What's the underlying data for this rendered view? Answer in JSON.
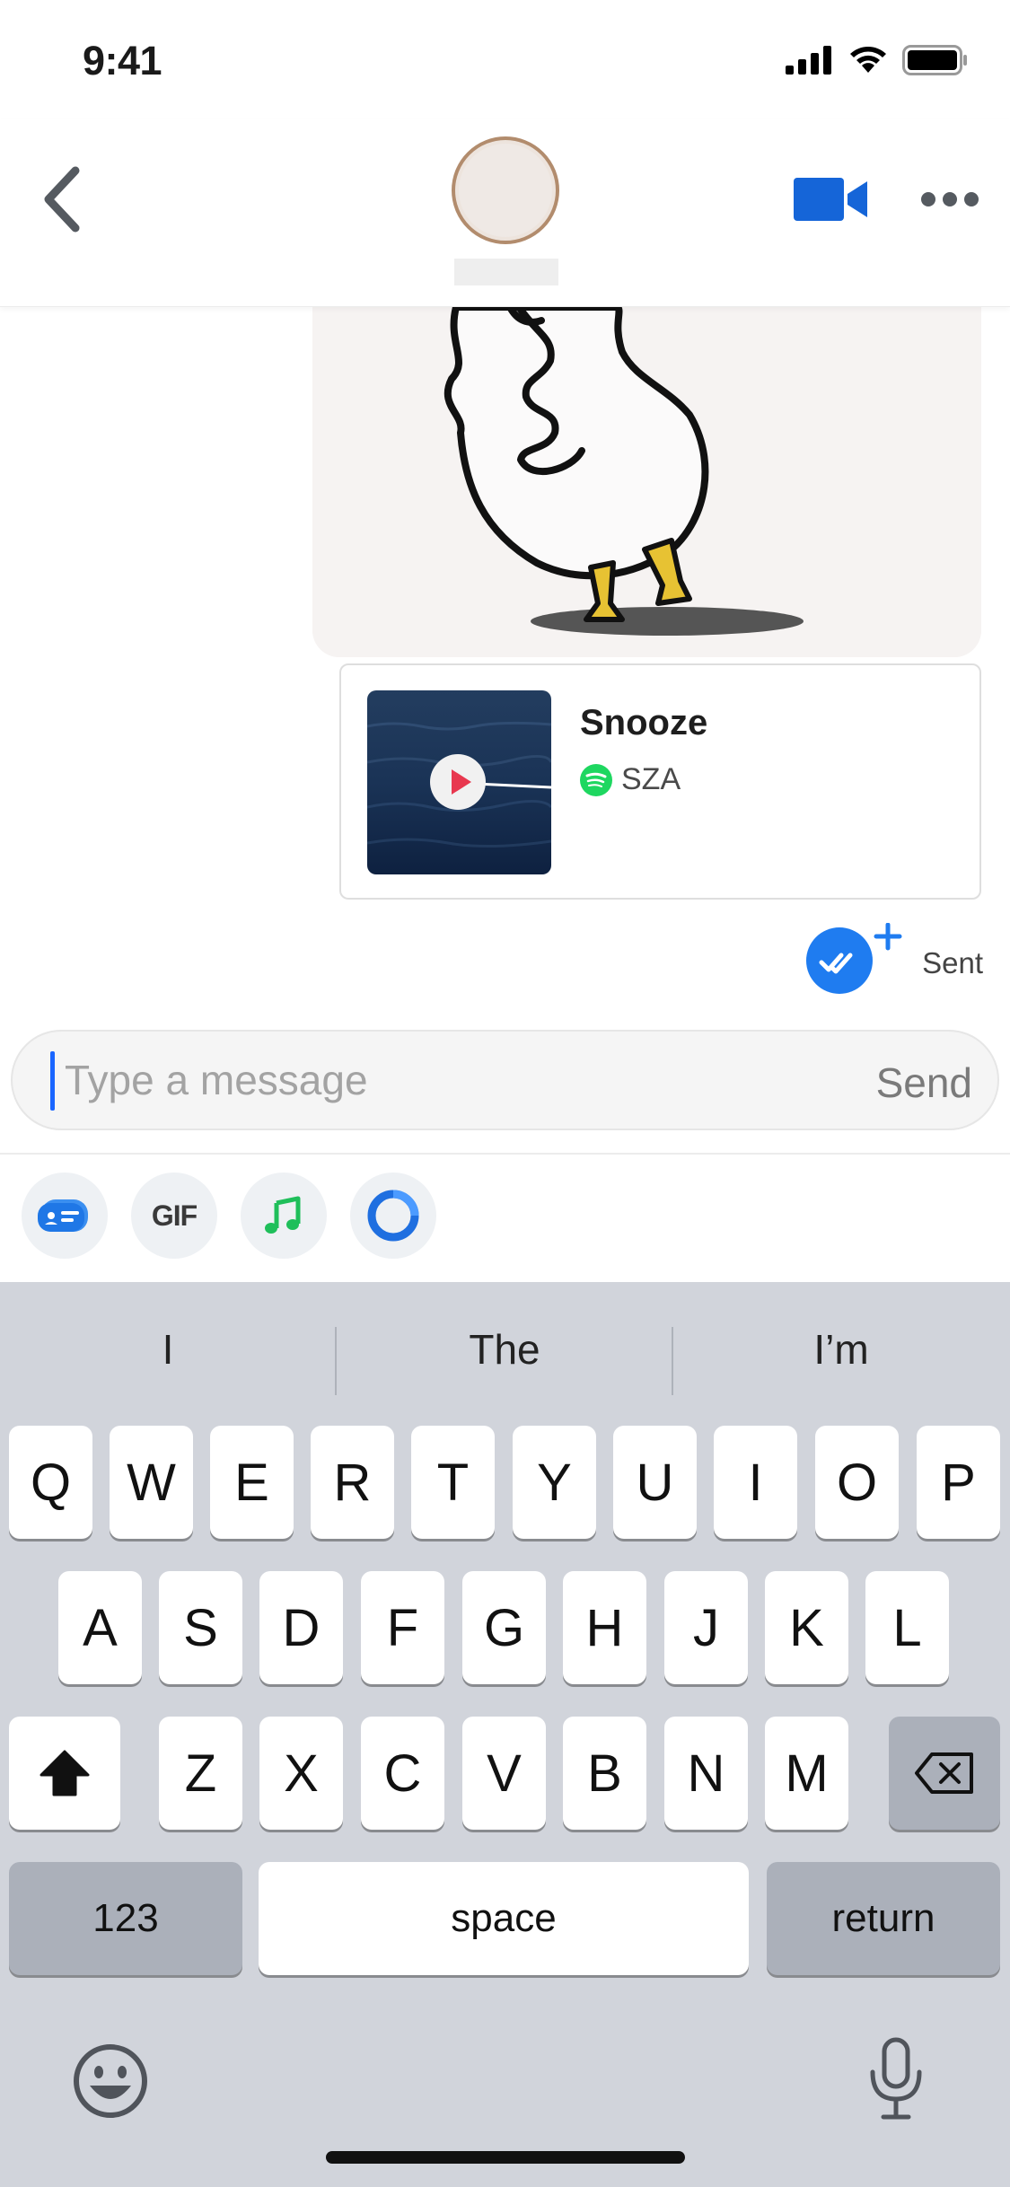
{
  "status_bar": {
    "time": "9:41"
  },
  "header": {
    "back_icon": "chevron-left-icon",
    "video_icon": "video-camera-icon",
    "more_icon": "more-dots-icon",
    "accent_color": "#1565d8"
  },
  "messages": {
    "music_card": {
      "title": "Snooze",
      "artist": "SZA",
      "service_icon": "spotify-icon",
      "play_icon": "play-icon"
    },
    "status": {
      "label": "Sent",
      "icon": "double-check-icon"
    }
  },
  "composer": {
    "placeholder": "Type a message",
    "value": "",
    "send_label": "Send"
  },
  "toolbar": {
    "gif_label": "GIF",
    "items": [
      "sticker-icon",
      "gif-icon",
      "music-note-icon",
      "circle-ring-icon"
    ]
  },
  "keyboard": {
    "suggestions": [
      "I",
      "The",
      "I’m"
    ],
    "row1": [
      "Q",
      "W",
      "E",
      "R",
      "T",
      "Y",
      "U",
      "I",
      "O",
      "P"
    ],
    "row2": [
      "A",
      "S",
      "D",
      "F",
      "G",
      "H",
      "J",
      "K",
      "L"
    ],
    "row3": [
      "Z",
      "X",
      "C",
      "V",
      "B",
      "N",
      "M"
    ],
    "numbers_label": "123",
    "space_label": "space",
    "return_label": "return"
  }
}
